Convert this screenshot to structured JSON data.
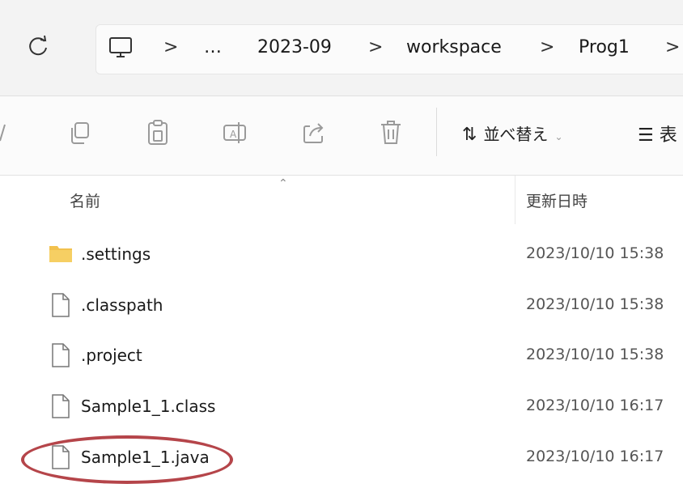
{
  "address_bar": {
    "breadcrumbs": [
      "2023-09",
      "workspace",
      "Prog1"
    ],
    "ellipsis": "…",
    "separator": ">"
  },
  "toolbar": {
    "sort_label": "並べ替え",
    "view_label": "表"
  },
  "columns": {
    "name": "名前",
    "date": "更新日時"
  },
  "files": [
    {
      "name": ".settings",
      "date": "2023/10/10 15:38",
      "icon": "folder-icon"
    },
    {
      "name": ".classpath",
      "date": "2023/10/10 15:38",
      "icon": "file-icon"
    },
    {
      "name": ".project",
      "date": "2023/10/10 15:38",
      "icon": "file-icon"
    },
    {
      "name": "Sample1_1.class",
      "date": "2023/10/10 16:17",
      "icon": "file-icon"
    },
    {
      "name": "Sample1_1.java",
      "date": "2023/10/10 16:17",
      "icon": "file-icon"
    }
  ],
  "colors": {
    "highlight": "#b5454a",
    "folder": "#f2c14e"
  }
}
